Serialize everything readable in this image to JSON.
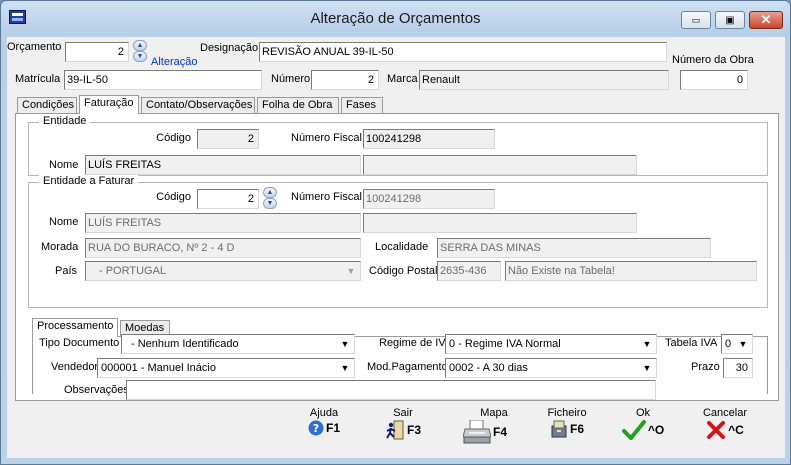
{
  "window": {
    "title": "Alteração de Orçamentos",
    "minimize": "▭",
    "maximize": "▣",
    "close": "✕"
  },
  "header": {
    "orcamento_label": "Orçamento Nº",
    "orcamento_value": "2",
    "alteracao_link": "Alteração",
    "designacao_label": "Designação",
    "designacao_value": "REVISÃO ANUAL 39-IL-50",
    "numero_obra_label": "Número da Obra",
    "numero_obra_value": "0",
    "matricula_label": "Matrícula",
    "matricula_value": "39-IL-50",
    "numero_label": "Número",
    "numero_value": "2",
    "marca_label": "Marca",
    "marca_value": "Renault"
  },
  "tabs": [
    "Condições",
    "Faturação",
    "Contato/Observações",
    "Folha de Obra",
    "Fases"
  ],
  "entidade": {
    "title": "Entidade",
    "codigo_label": "Código",
    "codigo_value": "2",
    "nif_label": "Número Fiscal",
    "nif_value": "100241298",
    "nome_label": "Nome",
    "nome_value": "LUÍS FREITAS"
  },
  "entidade_faturar": {
    "title": "Entidade a Faturar",
    "codigo_label": "Código",
    "codigo_value": "2",
    "nif_label": "Número Fiscal",
    "nif_value": "100241298",
    "nome_label": "Nome",
    "nome_value": "LUÍS FREITAS",
    "morada_label": "Morada",
    "morada_value": "RUA DO BURACO, Nº 2 - 4 D",
    "localidade_label": "Localidade",
    "localidade_value": "SERRA DAS MINAS",
    "pais_label": "País",
    "pais_value": "- PORTUGAL",
    "cp_label": "Código Postal",
    "cp_value": "2635-436",
    "cp_desc": "Não Existe na Tabela!"
  },
  "subtabs": [
    "Processamento",
    "Moedas"
  ],
  "processamento": {
    "tipo_doc_label": "Tipo Documento",
    "tipo_doc_value": "- Nenhum Identificado",
    "regime_iva_label": "Regime de IVA",
    "regime_iva_value": "0 - Regime IVA Normal",
    "tabela_iva_label": "Tabela IVA",
    "tabela_iva_value": "0",
    "vendedor_label": "Vendedor",
    "vendedor_value": "000001 - Manuel Inácio",
    "mod_pag_label": "Mod.Pagamento",
    "mod_pag_value": "0002 - A 30 dias",
    "prazo_label": "Prazo",
    "prazo_value": "30",
    "obs_label": "Observações",
    "obs_value": ""
  },
  "footer": [
    {
      "caption": "Ajuda",
      "key": "F1",
      "icon": "help-icon"
    },
    {
      "caption": "Sair",
      "key": "F3",
      "icon": "exit-icon"
    },
    {
      "caption": "Mapa",
      "key": "F4",
      "icon": "printer-icon"
    },
    {
      "caption": "Ficheiro",
      "key": "F6",
      "icon": "file-icon"
    },
    {
      "caption": "Ok",
      "key": "^O",
      "icon": "check-icon"
    },
    {
      "caption": "Cancelar",
      "key": "^C",
      "icon": "cancel-icon"
    }
  ],
  "colors": {
    "link": "#0033cc",
    "ok": "#1fa31f",
    "cancel": "#d4141c",
    "help": "#2f6fd0"
  }
}
